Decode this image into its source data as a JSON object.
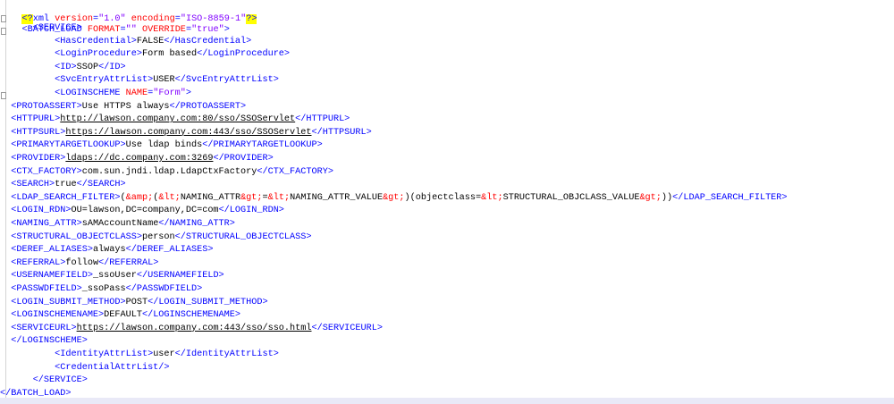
{
  "prolog": {
    "open": "<?",
    "name": "xml",
    "version_attr": "version",
    "version_val": "\"1.0\"",
    "encoding_attr": "encoding",
    "encoding_val": "\"ISO-8859-1\"",
    "close": "?>"
  },
  "batch_load": {
    "open_tag": "<BATCH_LOAD",
    "attr1": "FORMAT",
    "val1": "\"\"",
    "attr2": "OVERRIDE",
    "val2": "\"true\"",
    "close": ">"
  },
  "lines": [
    {
      "indent": "      ",
      "parts": [
        {
          "k": "t",
          "s": "<SERVICE>"
        }
      ]
    },
    {
      "indent": "          ",
      "parts": [
        {
          "k": "t",
          "s": "<HasCredential>"
        },
        {
          "k": "x",
          "s": "FALSE"
        },
        {
          "k": "t",
          "s": "</HasCredential>"
        }
      ]
    },
    {
      "indent": "          ",
      "parts": [
        {
          "k": "t",
          "s": "<LoginProcedure>"
        },
        {
          "k": "x",
          "s": "Form based"
        },
        {
          "k": "t",
          "s": "</LoginProcedure>"
        }
      ]
    },
    {
      "indent": "          ",
      "parts": [
        {
          "k": "t",
          "s": "<ID>"
        },
        {
          "k": "x",
          "s": "SSOP"
        },
        {
          "k": "t",
          "s": "</ID>"
        }
      ]
    },
    {
      "indent": "          ",
      "parts": [
        {
          "k": "t",
          "s": "<SvcEntryAttrList>"
        },
        {
          "k": "x",
          "s": "USER"
        },
        {
          "k": "t",
          "s": "</SvcEntryAttrList>"
        }
      ]
    },
    {
      "indent": "          ",
      "parts": [
        {
          "k": "t",
          "s": "<LOGINSCHEME "
        },
        {
          "k": "a",
          "s": "NAME"
        },
        {
          "k": "t",
          "s": "="
        },
        {
          "k": "v",
          "s": "\"Form\""
        },
        {
          "k": "t",
          "s": ">"
        }
      ]
    },
    {
      "indent": "  ",
      "parts": [
        {
          "k": "t",
          "s": "<PROTOASSERT>"
        },
        {
          "k": "x",
          "s": "Use HTTPS always"
        },
        {
          "k": "t",
          "s": "</PROTOASSERT>"
        }
      ]
    },
    {
      "indent": "  ",
      "parts": [
        {
          "k": "t",
          "s": "<HTTPURL>"
        },
        {
          "k": "u",
          "s": "http://lawson.company.com:80/sso/SSOServlet"
        },
        {
          "k": "t",
          "s": "</HTTPURL>"
        }
      ]
    },
    {
      "indent": "  ",
      "parts": [
        {
          "k": "t",
          "s": "<HTTPSURL>"
        },
        {
          "k": "u",
          "s": "https://lawson.company.com:443/sso/SSOServlet"
        },
        {
          "k": "t",
          "s": "</HTTPSURL>"
        }
      ]
    },
    {
      "indent": "  ",
      "parts": [
        {
          "k": "t",
          "s": "<PRIMARYTARGETLOOKUP>"
        },
        {
          "k": "x",
          "s": "Use ldap binds"
        },
        {
          "k": "t",
          "s": "</PRIMARYTARGETLOOKUP>"
        }
      ]
    },
    {
      "indent": "  ",
      "parts": [
        {
          "k": "t",
          "s": "<PROVIDER>"
        },
        {
          "k": "u",
          "s": "ldaps://dc.company.com:3269"
        },
        {
          "k": "t",
          "s": "</PROVIDER>"
        }
      ]
    },
    {
      "indent": "  ",
      "parts": [
        {
          "k": "t",
          "s": "<CTX_FACTORY>"
        },
        {
          "k": "x",
          "s": "com.sun.jndi.ldap.LdapCtxFactory"
        },
        {
          "k": "t",
          "s": "</CTX_FACTORY>"
        }
      ]
    },
    {
      "indent": "  ",
      "parts": [
        {
          "k": "t",
          "s": "<SEARCH>"
        },
        {
          "k": "x",
          "s": "true"
        },
        {
          "k": "t",
          "s": "</SEARCH>"
        }
      ]
    },
    {
      "indent": "  ",
      "parts": [
        {
          "k": "t",
          "s": "<LDAP_SEARCH_FILTER>"
        },
        {
          "k": "x",
          "s": "("
        },
        {
          "k": "e",
          "s": "&amp;"
        },
        {
          "k": "x",
          "s": "("
        },
        {
          "k": "e",
          "s": "&lt;"
        },
        {
          "k": "x",
          "s": "NAMING_ATTR"
        },
        {
          "k": "e",
          "s": "&gt;"
        },
        {
          "k": "x",
          "s": "="
        },
        {
          "k": "e",
          "s": "&lt;"
        },
        {
          "k": "x",
          "s": "NAMING_ATTR_VALUE"
        },
        {
          "k": "e",
          "s": "&gt;"
        },
        {
          "k": "x",
          "s": ")(objectclass="
        },
        {
          "k": "e",
          "s": "&lt;"
        },
        {
          "k": "x",
          "s": "STRUCTURAL_OBJCLASS_VALUE"
        },
        {
          "k": "e",
          "s": "&gt;"
        },
        {
          "k": "x",
          "s": "))"
        },
        {
          "k": "t",
          "s": "</LDAP_SEARCH_FILTER>"
        }
      ]
    },
    {
      "indent": "  ",
      "parts": [
        {
          "k": "t",
          "s": "<LOGIN_RDN>"
        },
        {
          "k": "x",
          "s": "OU=lawson,DC=company,DC=com"
        },
        {
          "k": "t",
          "s": "</LOGIN_RDN>"
        }
      ]
    },
    {
      "indent": "  ",
      "parts": [
        {
          "k": "t",
          "s": "<NAMING_ATTR>"
        },
        {
          "k": "x",
          "s": "sAMAccountName"
        },
        {
          "k": "t",
          "s": "</NAMING_ATTR>"
        }
      ]
    },
    {
      "indent": "  ",
      "parts": [
        {
          "k": "t",
          "s": "<STRUCTURAL_OBJECTCLASS>"
        },
        {
          "k": "x",
          "s": "person"
        },
        {
          "k": "t",
          "s": "</STRUCTURAL_OBJECTCLASS>"
        }
      ]
    },
    {
      "indent": "  ",
      "parts": [
        {
          "k": "t",
          "s": "<DEREF_ALIASES>"
        },
        {
          "k": "x",
          "s": "always"
        },
        {
          "k": "t",
          "s": "</DEREF_ALIASES>"
        }
      ]
    },
    {
      "indent": "  ",
      "parts": [
        {
          "k": "t",
          "s": "<REFERRAL>"
        },
        {
          "k": "x",
          "s": "follow"
        },
        {
          "k": "t",
          "s": "</REFERRAL>"
        }
      ]
    },
    {
      "indent": "  ",
      "parts": [
        {
          "k": "t",
          "s": "<USERNAMEFIELD>"
        },
        {
          "k": "x",
          "s": "_ssoUser"
        },
        {
          "k": "t",
          "s": "</USERNAMEFIELD>"
        }
      ]
    },
    {
      "indent": "  ",
      "parts": [
        {
          "k": "t",
          "s": "<PASSWDFIELD>"
        },
        {
          "k": "x",
          "s": "_ssoPass"
        },
        {
          "k": "t",
          "s": "</PASSWDFIELD>"
        }
      ]
    },
    {
      "indent": "  ",
      "parts": [
        {
          "k": "t",
          "s": "<LOGIN_SUBMIT_METHOD>"
        },
        {
          "k": "x",
          "s": "POST"
        },
        {
          "k": "t",
          "s": "</LOGIN_SUBMIT_METHOD>"
        }
      ]
    },
    {
      "indent": "  ",
      "parts": [
        {
          "k": "t",
          "s": "<LOGINSCHEMENAME>"
        },
        {
          "k": "x",
          "s": "DEFAULT"
        },
        {
          "k": "t",
          "s": "</LOGINSCHEMENAME>"
        }
      ]
    },
    {
      "indent": "  ",
      "parts": [
        {
          "k": "t",
          "s": "<SERVICEURL>"
        },
        {
          "k": "u",
          "s": "https://lawson.company.com:443/sso/sso.html"
        },
        {
          "k": "t",
          "s": "</SERVICEURL>"
        }
      ]
    },
    {
      "indent": "  ",
      "parts": [
        {
          "k": "t",
          "s": "</LOGINSCHEME>"
        }
      ]
    },
    {
      "indent": "          ",
      "parts": [
        {
          "k": "t",
          "s": "<IdentityAttrList>"
        },
        {
          "k": "x",
          "s": "user"
        },
        {
          "k": "t",
          "s": "</IdentityAttrList>"
        }
      ]
    },
    {
      "indent": "          ",
      "parts": [
        {
          "k": "t",
          "s": "<CredentialAttrList/>"
        }
      ]
    },
    {
      "indent": "      ",
      "parts": [
        {
          "k": "t",
          "s": "</SERVICE>"
        }
      ]
    },
    {
      "indent": "",
      "parts": [
        {
          "k": "t",
          "s": "</BATCH_LOAD>"
        }
      ]
    }
  ],
  "colors": {
    "tag": "#0000ff",
    "attribute": "#ff0000",
    "attribute_value": "#8000ff",
    "entity": "#ff0000",
    "text": "#000000",
    "prolog_highlight": "#ffff00"
  }
}
